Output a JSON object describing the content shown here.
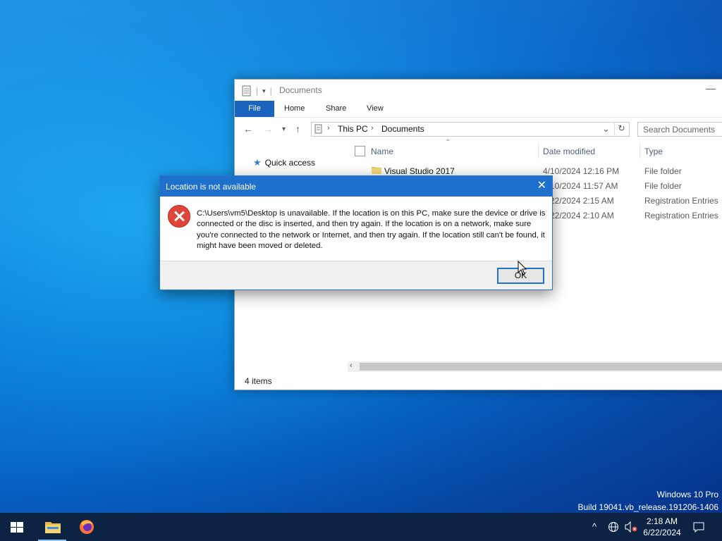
{
  "explorer": {
    "window_title": "Documents",
    "ribbon_tabs": [
      "File",
      "Home",
      "Share",
      "View"
    ],
    "address": [
      "This PC",
      "Documents"
    ],
    "search_placeholder": "Search Documents",
    "nav_quick_access": "Quick access",
    "columns": {
      "name": "Name",
      "date": "Date modified",
      "type": "Type"
    },
    "rows": [
      {
        "name": "Visual Studio 2017",
        "date": "4/10/2024 12:16 PM",
        "type": "File folder"
      },
      {
        "name": "",
        "date": "4/10/2024 11:57 AM",
        "type": "File folder"
      },
      {
        "name": "",
        "date": "6/22/2024 2:15 AM",
        "type": "Registration Entries"
      },
      {
        "name": "",
        "date": "6/22/2024 2:10 AM",
        "type": "Registration Entries"
      }
    ],
    "status": "4 items"
  },
  "dialog": {
    "title": "Location is not available",
    "message": "C:\\Users\\vm5\\Desktop is unavailable. If the location is on this PC, make sure the device or drive is connected or the disc is inserted, and then try again. If the location is on a network, make sure you're connected to the network or Internet, and then try again. If the location still can't be found, it might have been moved or deleted.",
    "ok_label": "OK"
  },
  "watermark": {
    "edition": "Windows 10 Pro",
    "build": "Build 19041.vb_release.191206-1406"
  },
  "taskbar": {
    "time": "2:18 AM",
    "date": "6/22/2024",
    "apps": [
      "file-explorer-icon",
      "firefox-icon"
    ]
  },
  "colors": {
    "accent": "#1e70cd",
    "taskbar": "#0c2344",
    "error": "#e0453b"
  }
}
